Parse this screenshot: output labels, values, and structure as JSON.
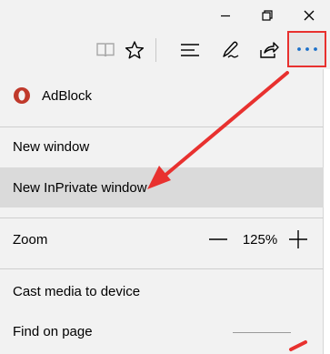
{
  "window": {
    "controls": [
      "minimize",
      "maximize",
      "close"
    ]
  },
  "toolbar": {
    "icons": [
      "reading-view-icon",
      "favorites-star-icon",
      "hub-icon",
      "web-note-icon",
      "share-icon",
      "more-actions-icon"
    ]
  },
  "menu": {
    "adblock": "AdBlock",
    "new_window": "New window",
    "new_inprivate": "New InPrivate window",
    "zoom_label": "Zoom",
    "zoom_value": "125%",
    "cast": "Cast media to device",
    "find": "Find on page"
  },
  "colors": {
    "accent_red": "#e8312f",
    "adblock_red": "#c0392b",
    "menu_bg": "#f2f2f2",
    "highlight_bg": "#dadada"
  }
}
